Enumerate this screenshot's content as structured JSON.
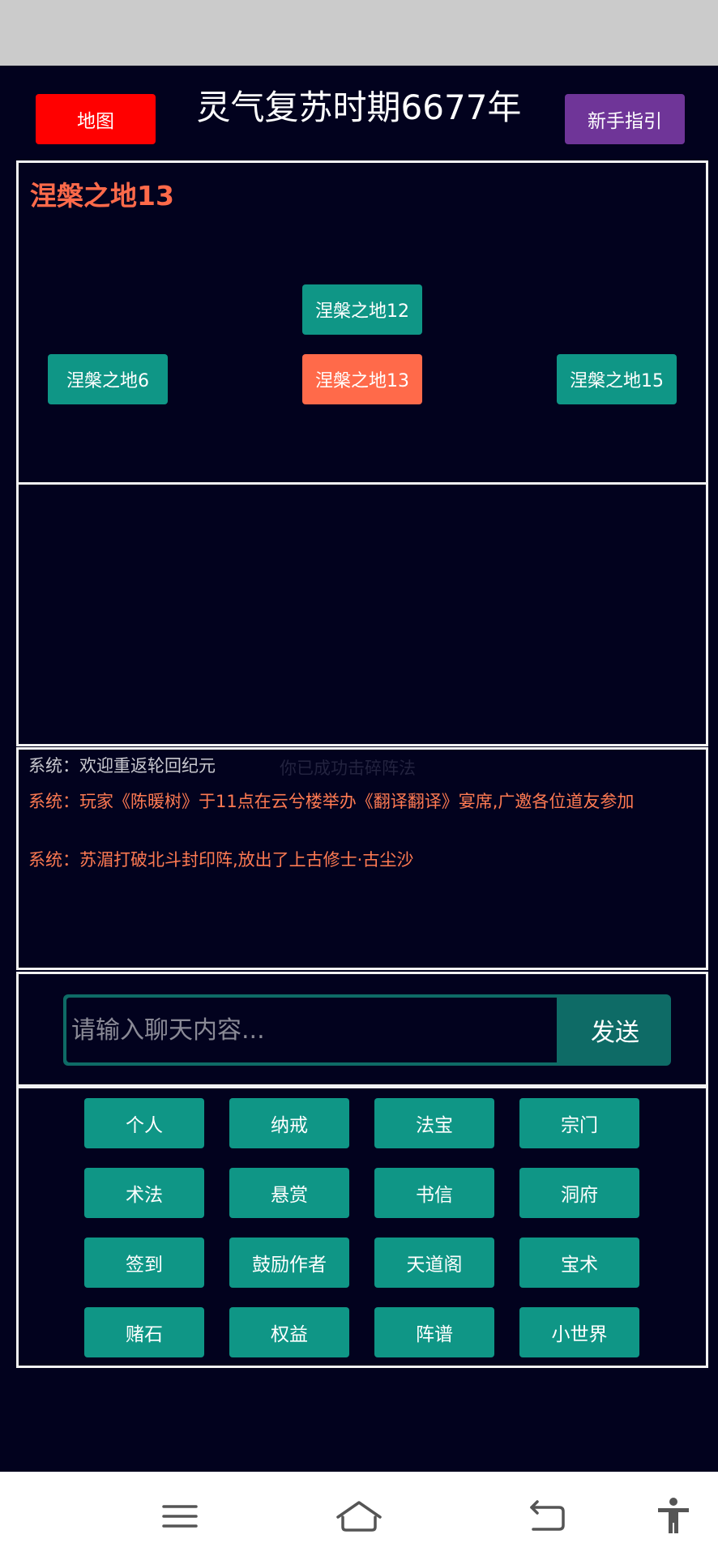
{
  "header": {
    "map_label": "地图",
    "era_title": "灵气复苏时期6677年",
    "guide_label": "新手指引"
  },
  "map_panel": {
    "location_title": "涅槃之地13",
    "nodes": [
      {
        "label": "涅槃之地12",
        "current": false
      },
      {
        "label": "涅槃之地6",
        "current": false
      },
      {
        "label": "涅槃之地13",
        "current": true
      },
      {
        "label": "涅槃之地15",
        "current": false
      }
    ]
  },
  "log": {
    "ghost_text": "你已成功击碎阵法",
    "lines": [
      {
        "text": "系统：欢迎重返轮回纪元",
        "color": "#c9c9cf"
      },
      {
        "text": "系统：玩家《陈暖树》于11点在云兮楼举办《翻译翻译》宴席,广邀各位道友参加",
        "color": "#ff7a52"
      },
      {
        "text": "系统：苏湄打破北斗封印阵,放出了上古修士·古尘沙",
        "color": "#ff7a52"
      }
    ]
  },
  "chat": {
    "placeholder": "请输入聊天内容...",
    "send_label": "发送"
  },
  "menu": {
    "items": [
      "个人",
      "纳戒",
      "法宝",
      "宗门",
      "术法",
      "悬赏",
      "书信",
      "洞府",
      "签到",
      "鼓励作者",
      "天道阁",
      "宝术",
      "赌石",
      "权益",
      "阵谱",
      "小世界"
    ]
  },
  "colors": {
    "background": "#02021e",
    "teal": "#0f9686",
    "accent_orange": "#ff6a4a",
    "map_red": "#ff0000",
    "guide_purple": "#6f3598"
  },
  "navbar": {
    "icons": [
      "menu-icon",
      "home-icon",
      "back-icon",
      "accessibility-icon"
    ]
  }
}
